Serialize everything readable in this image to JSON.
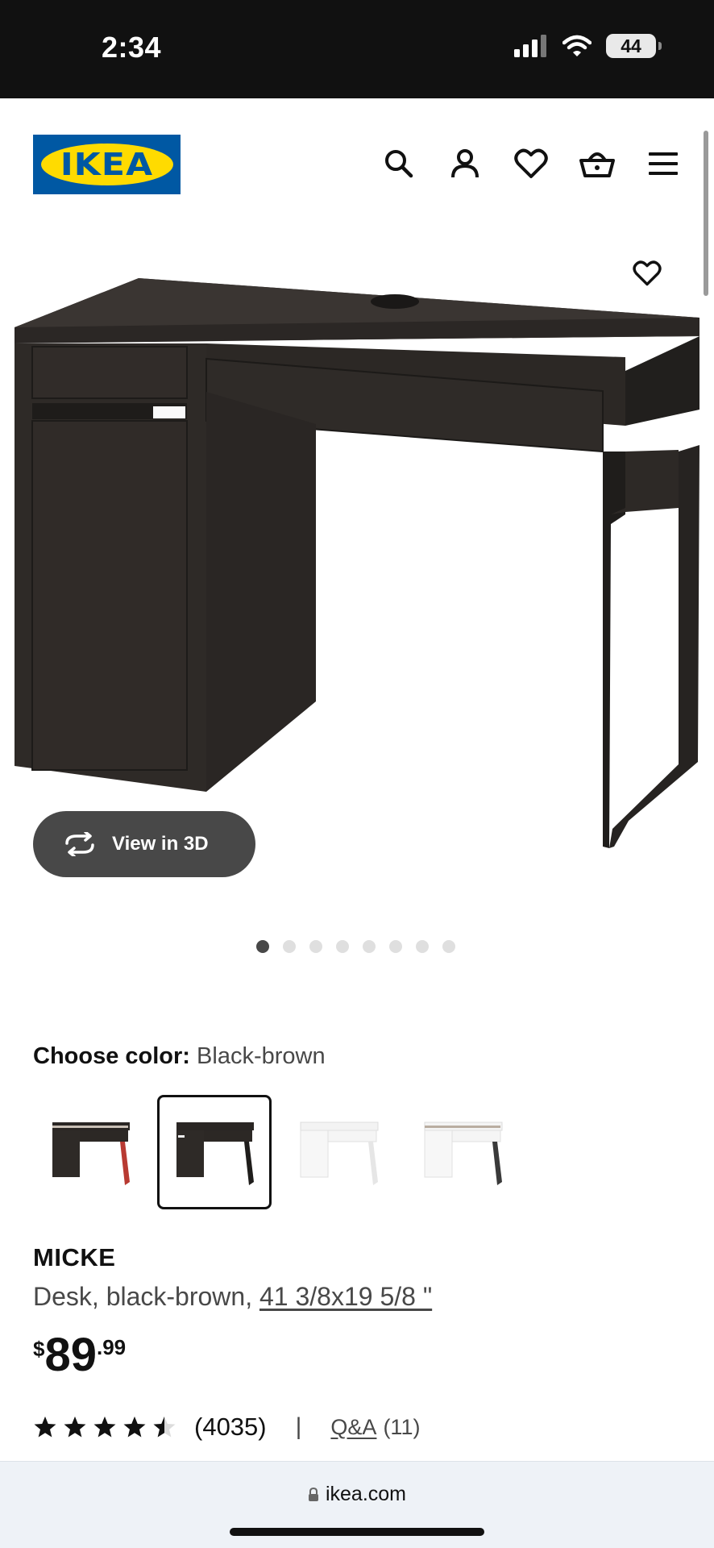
{
  "status_bar": {
    "time": "2:34",
    "battery": "44"
  },
  "header": {
    "logo_text": "IKEA",
    "icons": [
      "search-icon",
      "user-icon",
      "heart-icon",
      "basket-icon",
      "menu-icon"
    ]
  },
  "gallery": {
    "view3d_label": "View in 3D",
    "image_count": 8,
    "active_image": 1
  },
  "color_picker": {
    "label": "Choose color:",
    "selected": "Black-brown",
    "options": [
      "Black-brown/red",
      "Black-brown",
      "White",
      "White/anthracite"
    ]
  },
  "product": {
    "name": "MICKE",
    "description_prefix": "Desk, black-brown, ",
    "measurement": "41 3/8x19 5/8 \"",
    "price_currency": "$",
    "price_integer": "89",
    "price_decimal": ".99",
    "rating_value": 4.5,
    "review_count": "(4035)",
    "separator": "|",
    "qa_label": "Q&A",
    "qa_count": "(11)"
  },
  "browser": {
    "url": "ikea.com"
  },
  "colors": {
    "ikea_blue": "#0058a3",
    "ikea_yellow": "#ffdb00",
    "desk": "#2e2a27"
  }
}
